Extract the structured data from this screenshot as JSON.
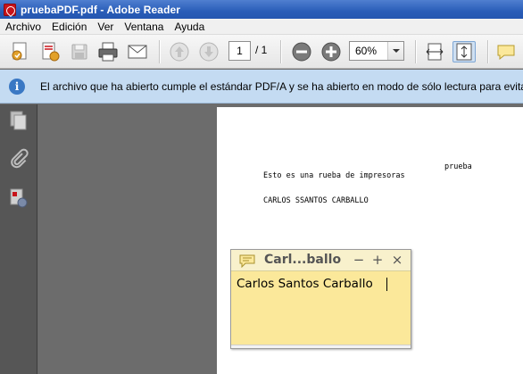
{
  "window": {
    "title": "pruebaPDF.pdf - Adobe Reader"
  },
  "menu": {
    "items": [
      "Archivo",
      "Edición",
      "Ver",
      "Ventana",
      "Ayuda"
    ]
  },
  "toolbar": {
    "icons": [
      "create-pdf-icon",
      "combine-files-icon",
      "save-icon",
      "print-icon",
      "email-icon",
      "previous-page-icon",
      "next-page-icon",
      "zoom-out-icon",
      "zoom-in-icon",
      "fit-page-width-icon",
      "fit-page-icon",
      "comment-icon"
    ],
    "page_number": "1",
    "page_total": "/ 1",
    "zoom": "60%"
  },
  "infobar": {
    "message": "El archivo que ha abierto cumple el estándar PDF/A y se ha abierto en modo de sólo lectura para evitar"
  },
  "navpanel": {
    "icons": [
      "pages-icon",
      "attachments-icon",
      "signatures-icon"
    ]
  },
  "document": {
    "heading_right": "prueba",
    "line1": "Esto es una rueba de impresoras",
    "line2": "CARLOS SSANTOS CARBALLO"
  },
  "note": {
    "title": "Carl...ballo",
    "content": "Carlos Santos Carballo",
    "minimize": "−",
    "maximize": "+",
    "close": "×"
  },
  "colors": {
    "titlebar": "#2a5db8",
    "infobar": "#c4dbf2",
    "note": "#fbe89a",
    "doc_background": "#6c6c6c"
  }
}
